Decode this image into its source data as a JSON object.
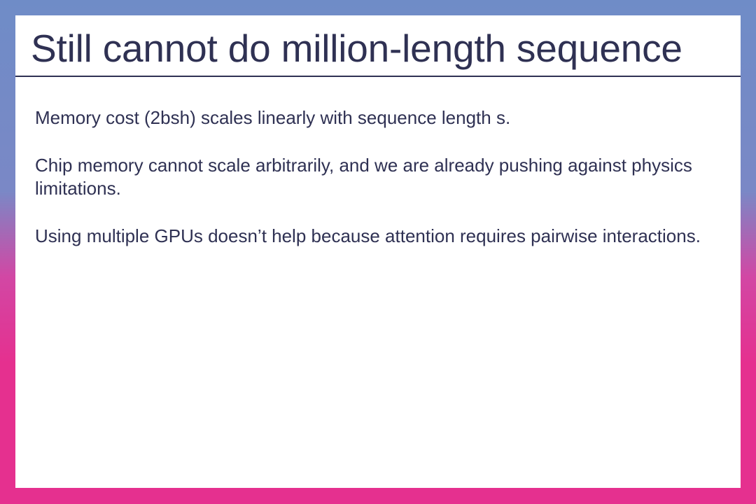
{
  "slide": {
    "title": "Still cannot do million-length sequence",
    "paragraphs": [
      "Memory cost (2bsh) scales linearly with sequence length s.",
      "Chip memory cannot scale arbitrarily, and we are already pushing against physics limitations.",
      "Using multiple GPUs doesn’t help because attention requires pairwise interactions."
    ]
  },
  "colors": {
    "text": "#2f3153",
    "background": "#ffffff",
    "border_top": "#6f8cc7",
    "border_bottom": "#e5308f"
  }
}
